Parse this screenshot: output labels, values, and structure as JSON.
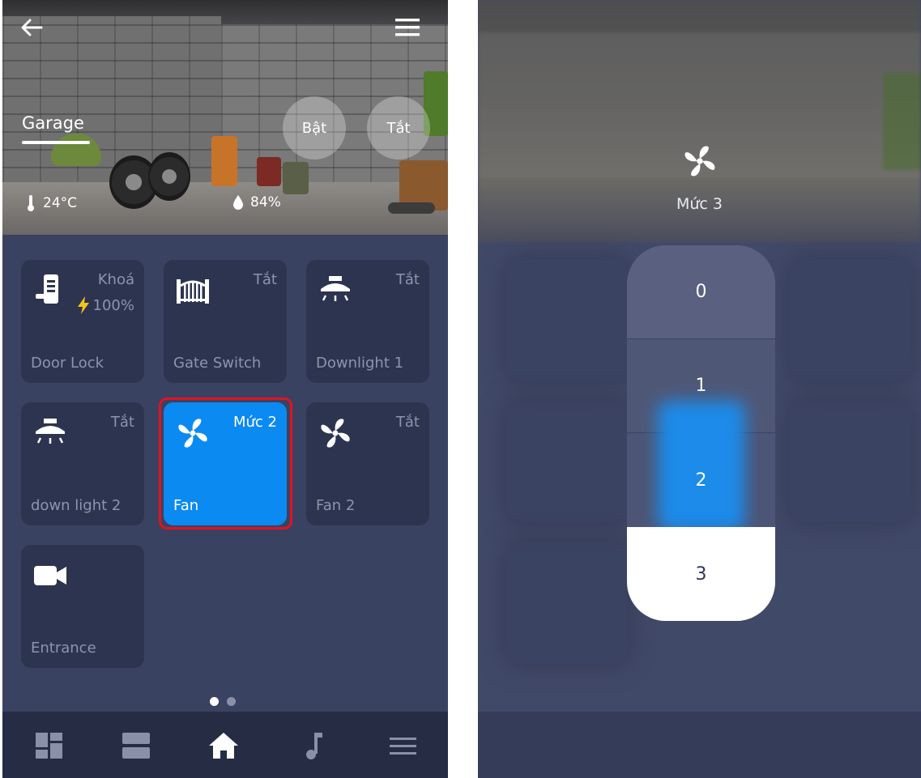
{
  "left": {
    "room_name": "Garage",
    "btn_on": "Bật",
    "btn_off": "Tắt",
    "temperature": "24°C",
    "humidity": "84%",
    "tiles": [
      {
        "name": "Door Lock",
        "status": "Khoá",
        "battery": "100%"
      },
      {
        "name": "Gate Switch",
        "status": "Tắt"
      },
      {
        "name": "Downlight 1",
        "status": "Tắt"
      },
      {
        "name": "down light 2",
        "status": "Tắt"
      },
      {
        "name": "Fan",
        "status": "Mức 2"
      },
      {
        "name": "Fan 2",
        "status": "Tắt"
      },
      {
        "name": "Entrance",
        "status": ""
      }
    ],
    "pages": 2,
    "active_page": 1,
    "nav_icons": [
      "dashboard-icon",
      "rooms-icon",
      "home-icon",
      "music-icon",
      "menu-icon"
    ]
  },
  "right": {
    "current_level": "Mức 3",
    "levels": [
      "0",
      "1",
      "2",
      "3"
    ],
    "selected_level": "3"
  },
  "colors": {
    "accent": "#0b8af2",
    "background": "#3a4262",
    "tile": "#2d344f",
    "highlight": "#e3121f"
  }
}
